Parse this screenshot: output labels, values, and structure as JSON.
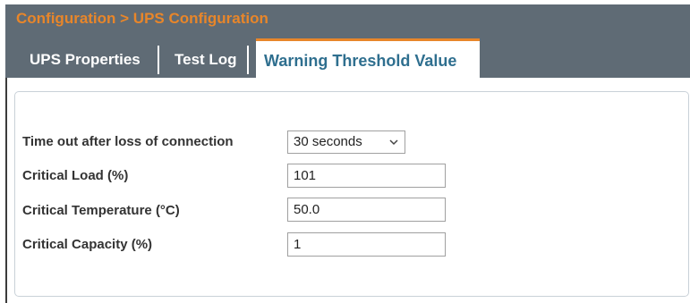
{
  "header": {
    "breadcrumb": "Configuration > UPS Configuration"
  },
  "tabs": [
    {
      "label": "UPS Properties",
      "active": false
    },
    {
      "label": "Test Log",
      "active": false
    },
    {
      "label": "Warning Threshold Value",
      "active": true
    }
  ],
  "form": {
    "timeout": {
      "label": "Time out after loss of connection",
      "value": "30 seconds"
    },
    "critical_load": {
      "label": "Critical Load (%)",
      "value": "101"
    },
    "critical_temperature": {
      "label": "Critical Temperature (°C)",
      "value": "50.0"
    },
    "critical_capacity": {
      "label": "Critical Capacity (%)",
      "value": "1"
    }
  },
  "colors": {
    "header_bg": "#5f6b75",
    "accent": "#e8862a",
    "active_tab_text": "#2f6f8f"
  }
}
